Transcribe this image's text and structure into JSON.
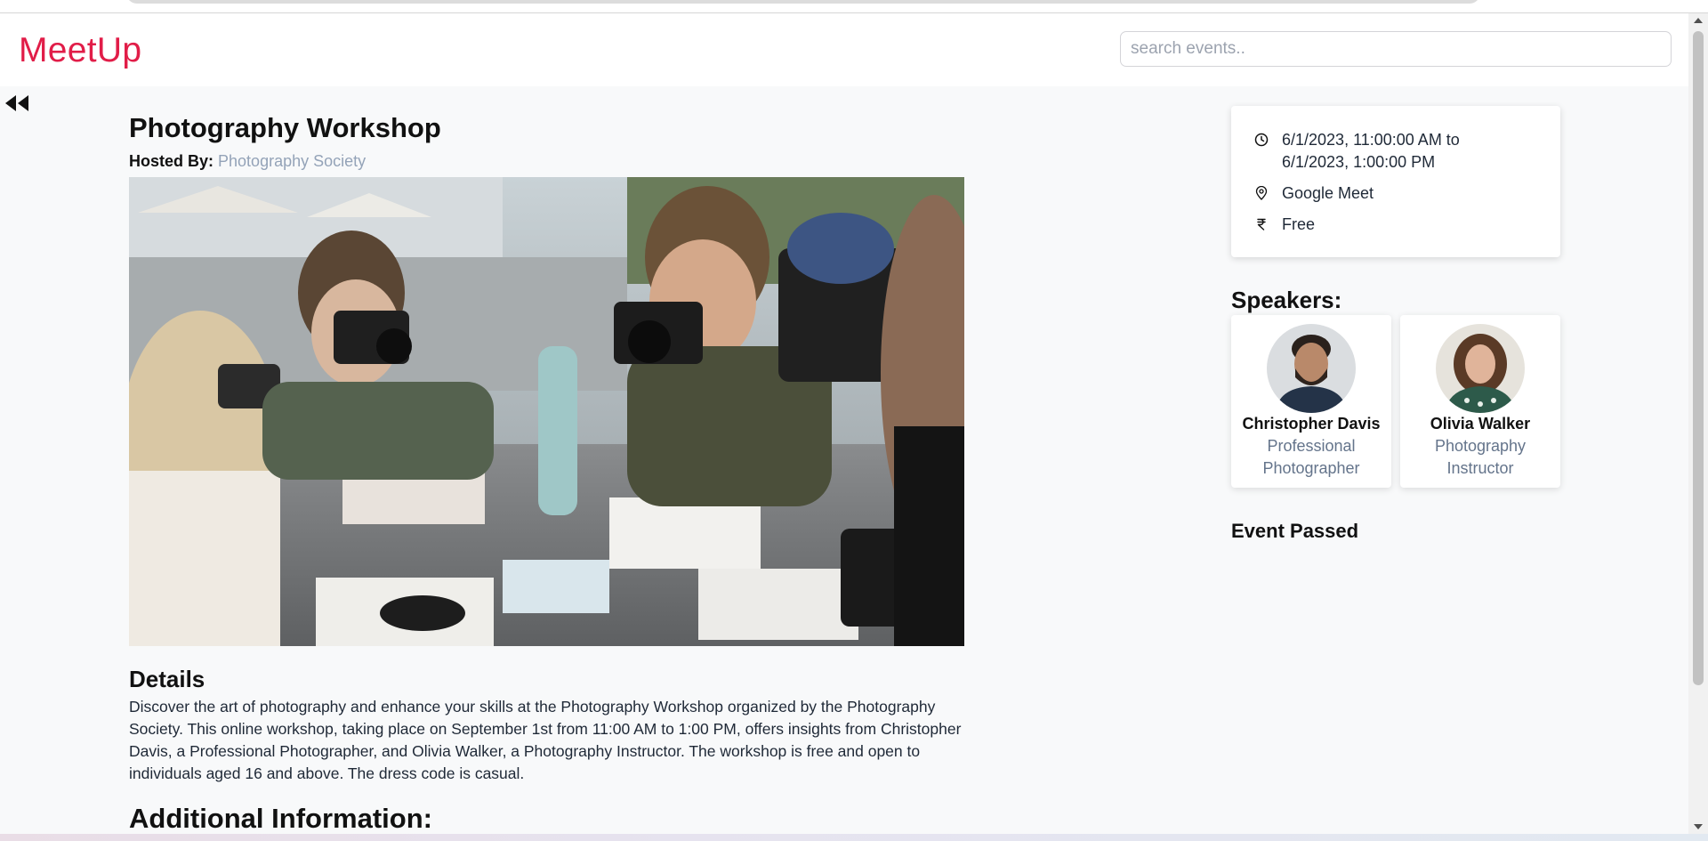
{
  "header": {
    "logo": "MeetUp",
    "search_placeholder": "search events.."
  },
  "event": {
    "title": "Photography Workshop",
    "hosted_label": "Hosted By:",
    "host": "Photography Society",
    "details_heading": "Details",
    "details_text": "Discover the art of photography and enhance your skills at the Photography Workshop organized by the Photography Society. This online workshop, taking place on September 1st from 11:00 AM to 1:00 PM, offers insights from Christopher Davis, a Professional Photographer, and Olivia Walker, a Photography Instructor. The workshop is free and open to individuals aged 16 and above. The dress code is casual.",
    "additional_heading": "Additional Information:"
  },
  "info": {
    "time_line1": "6/1/2023, 11:00:00 AM to",
    "time_line2": "6/1/2023, 1:00:00 PM",
    "location": "Google Meet",
    "price": "Free"
  },
  "speakers_heading": "Speakers:",
  "speakers": [
    {
      "name": "Christopher Davis",
      "role_line1": "Professional",
      "role_line2": "Photographer"
    },
    {
      "name": "Olivia Walker",
      "role_line1": "Photography",
      "role_line2": "Instructor"
    }
  ],
  "status": "Event Passed",
  "colors": {
    "brand": "#e11d48",
    "host_link": "#94a3b8",
    "role_text": "#64748b"
  },
  "icons": {
    "back": "double-left-arrow-icon",
    "time": "clock-icon",
    "location": "map-pin-icon",
    "price": "rupee-icon"
  }
}
